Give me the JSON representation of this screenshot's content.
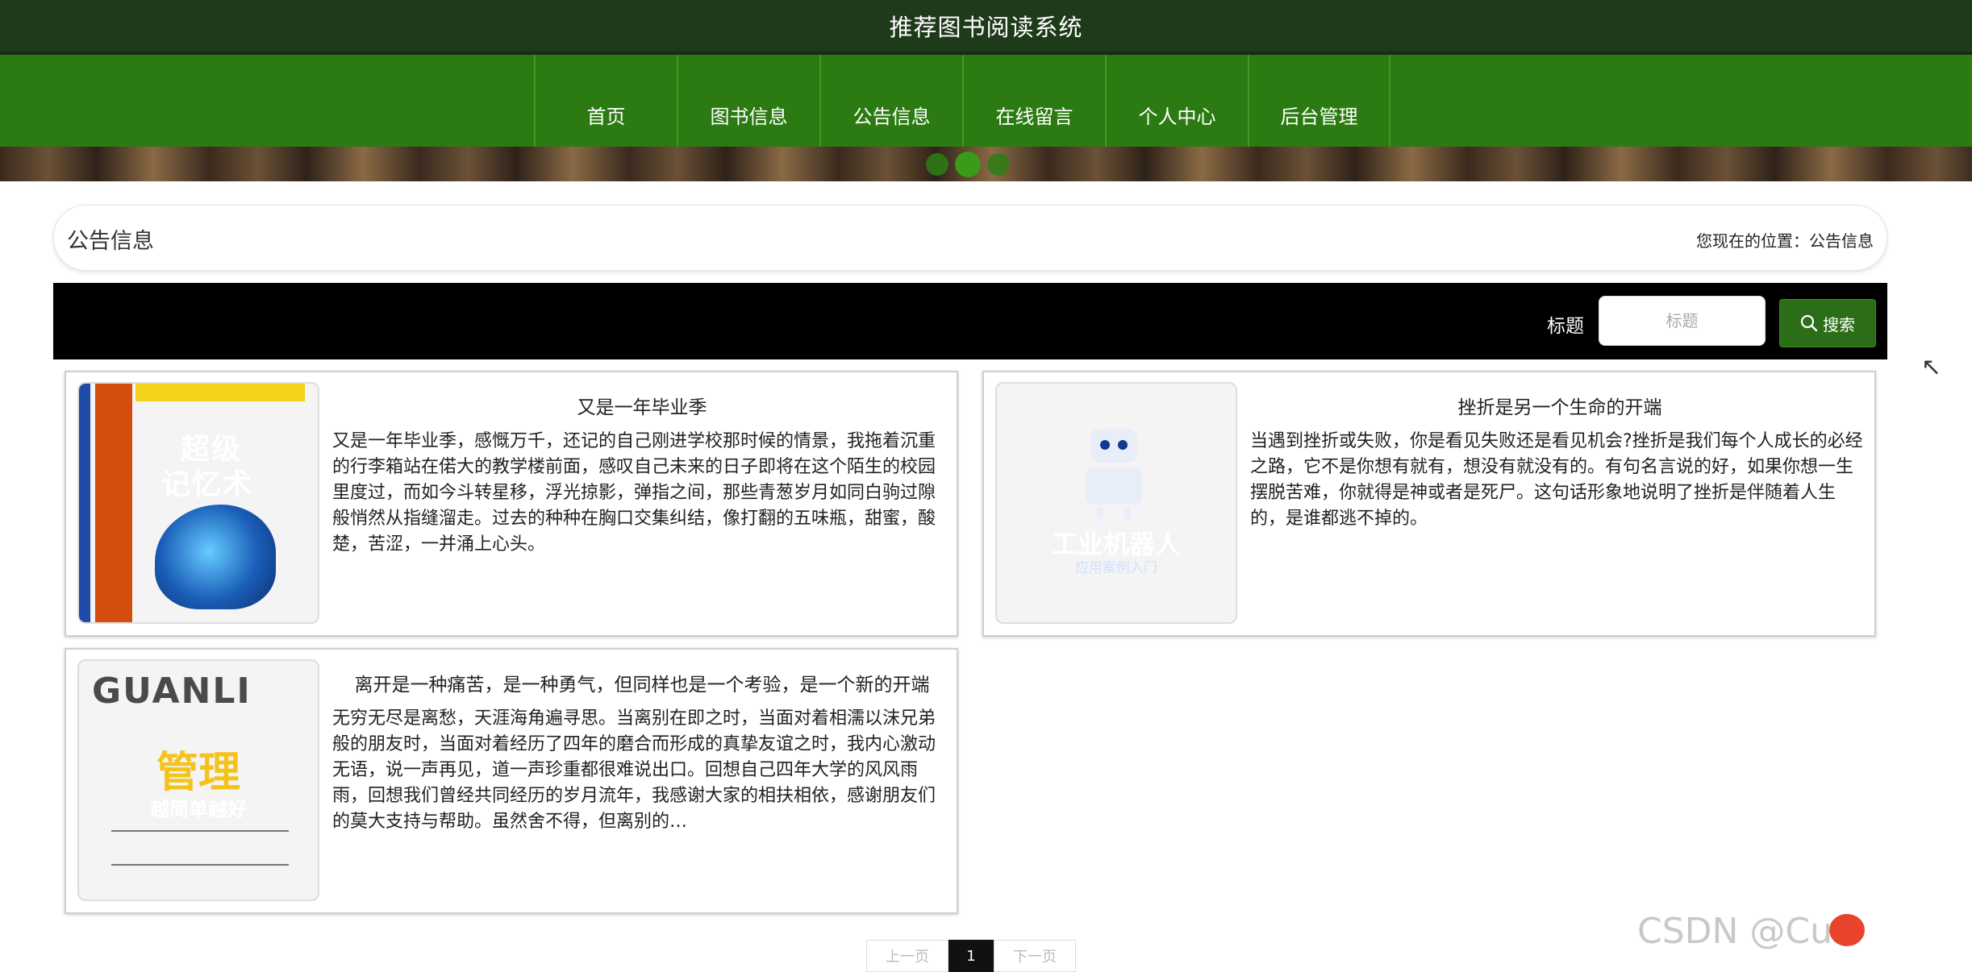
{
  "app": {
    "title": "推荐图书阅读系统"
  },
  "nav": {
    "items": [
      {
        "label": "首页"
      },
      {
        "label": "图书信息"
      },
      {
        "label": "公告信息"
      },
      {
        "label": "在线留言"
      },
      {
        "label": "个人中心"
      },
      {
        "label": "后台管理"
      }
    ]
  },
  "carousel": {
    "slide_count": 3,
    "active_index": 1
  },
  "breadcrumb": {
    "title": "公告信息",
    "location_prefix": "您现在的位置：",
    "location": "公告信息"
  },
  "search": {
    "label": "标题",
    "placeholder": "标题",
    "value": "",
    "button_label": "搜索",
    "icon": "search-icon"
  },
  "notices": [
    {
      "title": "又是一年毕业季",
      "body": "又是一年毕业季，感慨万千，还记的自己刚进学校那时候的情景，我拖着沉重的行李箱站在偌大的教学楼前面，感叹自己未来的日子即将在这个陌生的校园里度过，而如今斗转星移，浮光掠影，弹指之间，那些青葱岁月如同白驹过隙般悄然从指缝溜走。过去的种种在胸口交集纠结，像打翻的五味瓶，甜蜜，酸楚，苦涩，一并涌上心头。",
      "cover": {
        "title_line1": "超级",
        "title_line2": "记忆术"
      }
    },
    {
      "title": "挫折是另一个生命的开端",
      "body": "当遇到挫折或失败，你是看见失败还是看见机会?挫折是我们每个人成长的必经之路，它不是你想有就有，想没有就没有的。有句名言说的好，如果你想一生摆脱苦难，你就得是神或者是死尸。这句话形象地说明了挫折是伴随着人生的，是谁都逃不掉的。",
      "cover": {
        "title": "工业机器人",
        "subtitle": "应用案例入门"
      }
    },
    {
      "title": "离开是一种痛苦，是一种勇气，但同样也是一个考验，是一个新的开端",
      "body": "无穷无尽是离愁，天涯海角遍寻思。当离别在即之时，当面对着相濡以沫兄弟般的朋友时，当面对着经历了四年的磨合而形成的真挚友谊之时，我内心激动无语，说一声再见，道一声珍重都很难说出口。回想自己四年大学的风风雨雨，回想我们曾经共同经历的岁月流年，我感谢大家的相扶相依，感谢朋友们的莫大支持与帮助。虽然舍不得，但离别的…",
      "cover": {
        "title_top": "GUANLI",
        "title": "管理",
        "subtitle": "越简单越好"
      }
    }
  ],
  "pagination": {
    "prev_label": "上一页",
    "current": "1",
    "next_label": "下一页"
  },
  "watermark": {
    "text": "CSDN @Cu"
  },
  "colors": {
    "topbar": "#1f3a1b",
    "nav": "#2b7a12",
    "search_button": "#2b6e17",
    "search_bar": "#000000"
  }
}
